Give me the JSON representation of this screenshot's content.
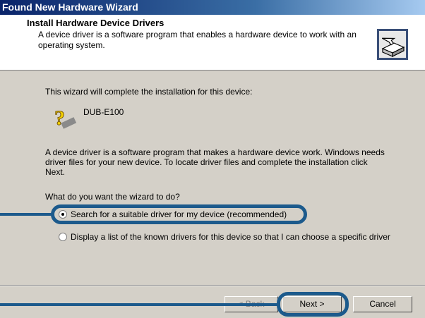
{
  "window": {
    "title": "Found New Hardware Wizard"
  },
  "header": {
    "title": "Install Hardware Device Drivers",
    "description": "A device driver is a software program that enables a hardware device to work with an operating system.",
    "icon": "hardware-install-icon"
  },
  "body": {
    "intro": "This wizard will complete the installation for this device:",
    "device_name": "DUB-E100",
    "device_icon": "unknown-device-icon",
    "explanation": "A device driver is a software program that makes a hardware device work. Windows needs driver files for your new device. To locate driver files and complete the installation click Next.",
    "question": "What do you want the wizard to do?",
    "options": [
      {
        "label": "Search for a suitable driver for my device (recommended)",
        "selected": true
      },
      {
        "label": "Display a list of the known drivers for this device so that I can choose a specific driver",
        "selected": false
      }
    ]
  },
  "buttons": {
    "back": "< Back",
    "next": "Next >",
    "cancel": "Cancel"
  },
  "colors": {
    "title_start": "#0a246a",
    "title_end": "#a6caf0",
    "dialog_bg": "#d4d0c8",
    "callout": "#1c5a8c"
  }
}
